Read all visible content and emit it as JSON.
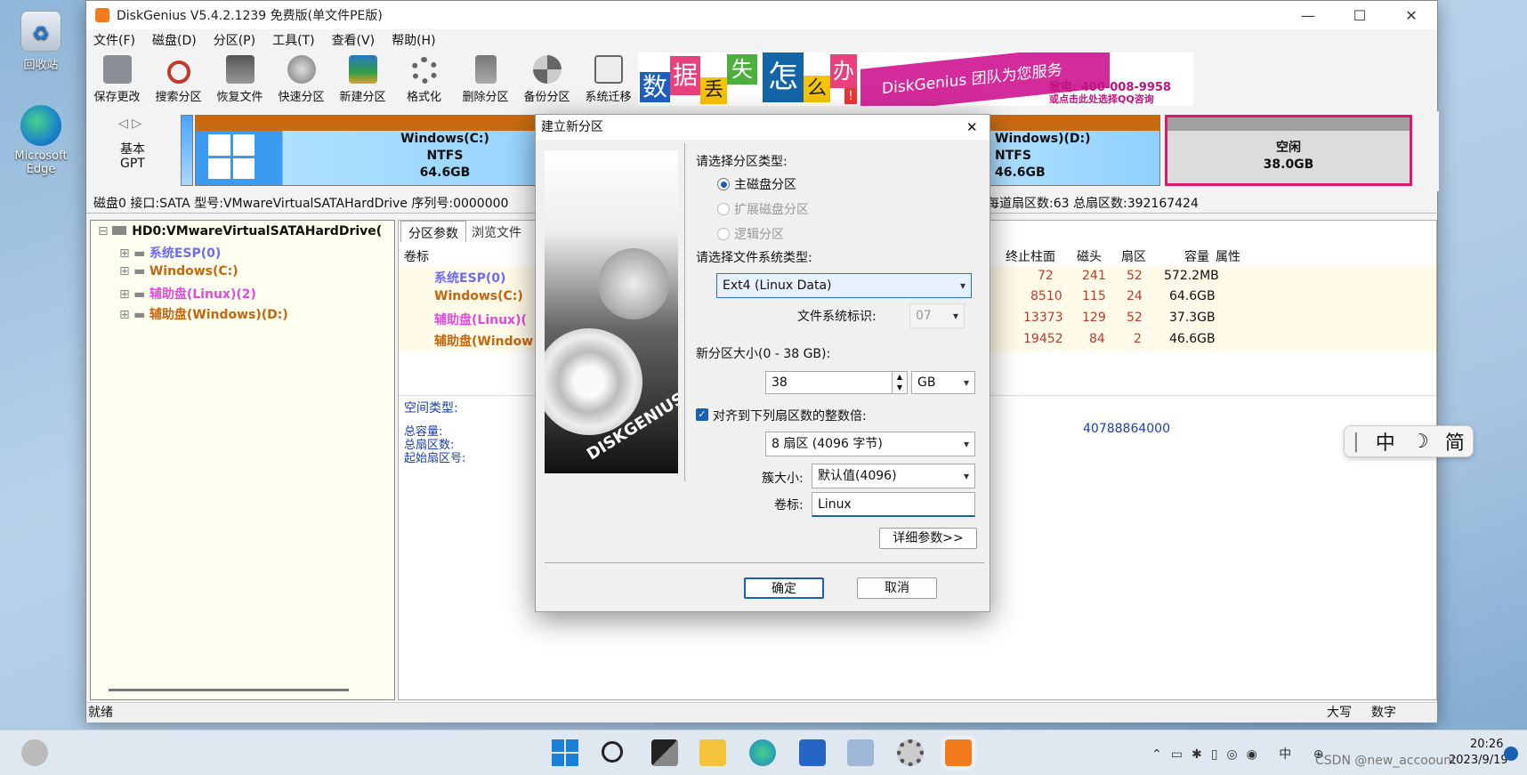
{
  "desktop": {
    "recycle_bin": "回收站",
    "edge": "Microsoft Edge"
  },
  "window": {
    "title": "DiskGenius V5.4.2.1239 免费版(单文件PE版)",
    "minimize": "—",
    "maximize": "☐",
    "close": "✕"
  },
  "menu": [
    "文件(F)",
    "磁盘(D)",
    "分区(P)",
    "工具(T)",
    "查看(V)",
    "帮助(H)"
  ],
  "toolbar": [
    "保存更改",
    "搜索分区",
    "恢复文件",
    "快速分区",
    "新建分区",
    "格式化",
    "删除分区",
    "备份分区",
    "系统迁移"
  ],
  "banner": {
    "chars": [
      "数",
      "据",
      "丢",
      "失",
      "怎",
      "么",
      "办",
      "!"
    ],
    "slogan": "DiskGenius 团队为您服务",
    "phone": "致电: 400-008-9958",
    "qq": "或点击此处选择QQ咨询"
  },
  "disk": {
    "nav": "◁ ▷",
    "type": "基本",
    "table": "GPT"
  },
  "segments": [
    {
      "name": "Windows(C:)",
      "fs": "NTFS",
      "size": "64.6GB"
    },
    {
      "name": "Windows)(D:)",
      "fs": "NTFS",
      "size": "46.6GB"
    },
    {
      "name": "空闲",
      "fs": "",
      "size": "38.0GB"
    }
  ],
  "info_line": {
    "left": "磁盘0 接口:SATA 型号:VMwareVirtualSATAHardDrive 序列号:0000000",
    "right": "每道扇区数:63 总扇区数:392167424"
  },
  "tree": {
    "root": "HD0:VMwareVirtualSATAHardDrive(",
    "items": [
      "系统ESP(0)",
      "Windows(C:)",
      "辅助盘(Linux)(2)",
      "辅助盘(Windows)(D:)"
    ]
  },
  "tabs": [
    "分区参数",
    "浏览文件"
  ],
  "table": {
    "label_header": "卷标",
    "headers": [
      "终止柱面",
      "磁头",
      "扇区",
      "容量",
      "属性"
    ],
    "rows": [
      {
        "name": "系统ESP(0)",
        "end": "72",
        "head": "241",
        "sector": "52",
        "size": "572.2MB"
      },
      {
        "name": "Windows(C:)",
        "end": "8510",
        "head": "115",
        "sector": "24",
        "size": "64.6GB"
      },
      {
        "name": "辅助盘(Linux)(",
        "end": "13373",
        "head": "129",
        "sector": "52",
        "size": "37.3GB"
      },
      {
        "name": "辅助盘(Window",
        "end": "19452",
        "head": "84",
        "sector": "2",
        "size": "46.6GB"
      }
    ]
  },
  "details": {
    "space_type": "空间类型:",
    "total": "总容量:",
    "sectors": "总扇区数:",
    "start": "起始扇区号:",
    "sector_value": "40788864000"
  },
  "status": {
    "ready": "就绪",
    "caps": "大写",
    "num": "数字"
  },
  "dialog": {
    "title": "建立新分区",
    "close": "✕",
    "part_type_label": "请选择分区类型:",
    "radio_primary": "主磁盘分区",
    "radio_extended": "扩展磁盘分区",
    "radio_logical": "逻辑分区",
    "fs_type_label": "请选择文件系统类型:",
    "fs_value": "Ext4 (Linux Data)",
    "fs_id_label": "文件系统标识:",
    "fs_id_value": "07",
    "size_label": "新分区大小(0 - 38 GB):",
    "size_value": "38",
    "size_unit": "GB",
    "align_label": "对齐到下列扇区数的整数倍:",
    "align_value": "8 扇区 (4096 字节)",
    "cluster_label": "簇大小:",
    "cluster_value": "默认值(4096)",
    "volume_label": "卷标:",
    "volume_value": "Linux",
    "detail_button": "详细参数>>",
    "ok_button": "确定",
    "cancel_button": "取消",
    "image_text": "DISKGENIUS"
  },
  "ime": [
    "|",
    "中",
    "☽",
    "简"
  ],
  "clock": {
    "time": "20:26",
    "date": "2023/9/19"
  },
  "watermark": "CSDN @new_accoount"
}
